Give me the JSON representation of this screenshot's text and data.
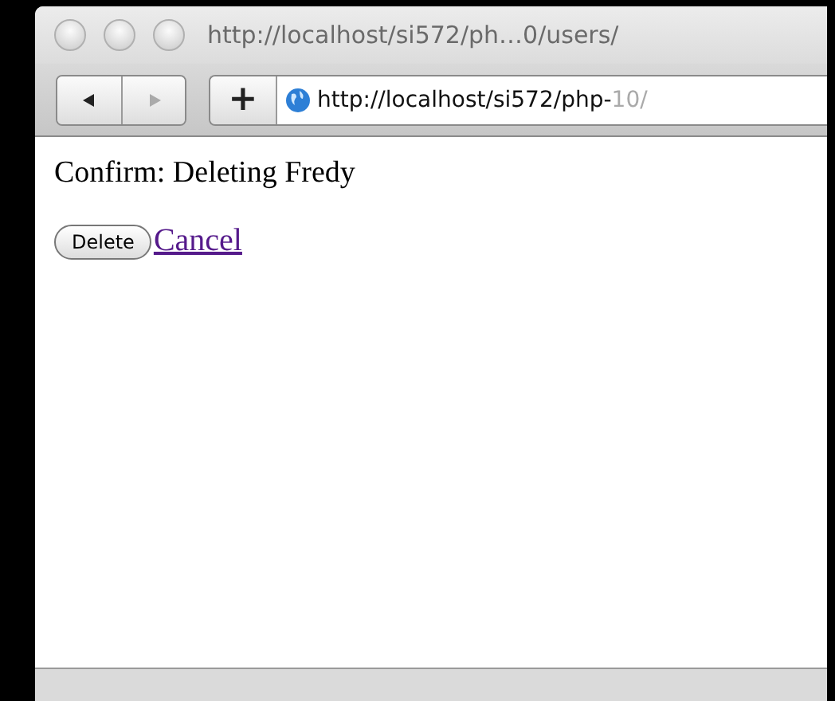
{
  "window": {
    "title": "http://localhost/si572/ph…0/users/"
  },
  "toolbar": {
    "nav_buttons": [
      {
        "kind": "back",
        "disabled": false
      },
      {
        "kind": "forward",
        "disabled": true
      }
    ],
    "add_button": "+",
    "address": {
      "text": "http://localhost/si572/php-",
      "faded_text": "10/"
    }
  },
  "page": {
    "heading": "Confirm: Deleting Fredy",
    "delete_button": "Delete",
    "cancel_link": "Cancel"
  }
}
